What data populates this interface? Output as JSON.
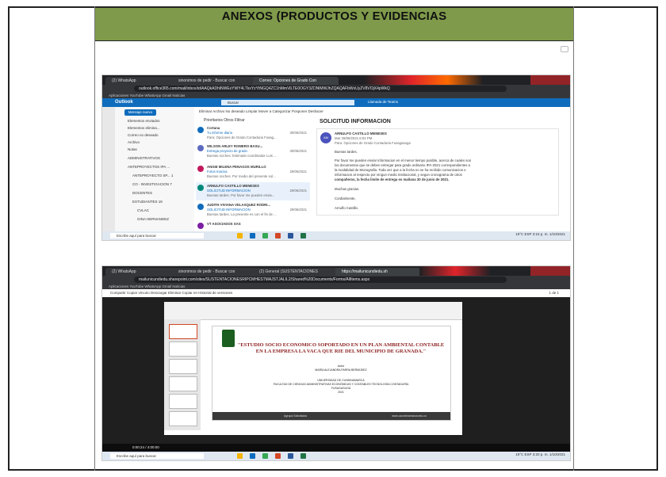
{
  "document": {
    "title": "ANEXOS (PRODUCTOS Y EVIDENCIAS"
  },
  "colors": {
    "header_bg": "#7f9a4a",
    "outlook_blue": "#0f6cbd",
    "taskbar": "#dfe7f1"
  },
  "outlook_screenshot": {
    "tabs": [
      "(2) WhatsApp",
      "sinonimos de pedir - Buscar con",
      "Correo: Opciones de Grado Con"
    ],
    "url": "outlook.office365.com/mail/inbox/id/AAQkADhlNWExYWY4LTkxYzYtNGQ4ZC1hMmVlLTE0OGY3ZDNlMWJhZQAQAFbWxUyZV8VOjX4pWkQ",
    "bookmarks": "Aplicaciones   YouTube   WhatsApp   Gmail   Noticias",
    "app_name": "Outlook",
    "search_placeholder": "Buscar",
    "header_text": "Llamada de Teams",
    "new_message": "Mensaje nuevo",
    "folders": [
      "Elementos enviados",
      "Elementos elimina...",
      "Correo no deseado",
      "Archivo",
      "Notas",
      "ADMINISTRATIVOS",
      "ANTEPROYECTOS IPA ...",
      "ANTEPROYECTO SP... 1",
      "CO - INVESTIGACION 7",
      "DOCENTES",
      "ESTUDIANTES 19",
      "CVLAC",
      "GINA HERNANDEZ"
    ],
    "toolbar": "Eliminar   Archivo   No deseado   Limpiar   Mover a   Categorizar   Posponer   Deshacer",
    "list_tabs": "Prioritarios   Otros          Filtrar",
    "messages": [
      {
        "from": "Cortana",
        "subject": "Tu informe diario",
        "preview": "Para: Opciones de Grado Contaduria Fusag...",
        "date": "30/06/2021"
      },
      {
        "from": "WILSON ARLEY ROMERO BASU...",
        "subject": "Entrega proyecto de grado",
        "preview": "Buenas noches. Estimado coordinador Luis ...",
        "date": "30/06/2021"
      },
      {
        "from": "ANGIE MILENA PENAGOS MURILLO",
        "subject": "Fotos Inaciva",
        "preview": "Buenas noches. Por medio del presente sol...",
        "date": "29/06/2021"
      },
      {
        "from": "ARNULFO CASTILLO MENESES",
        "subject": "SOLICITUD INFORMACION",
        "preview": "Buenas tardes. Por favor me pueden envia...",
        "date": "29/06/2021"
      },
      {
        "from": "JUDITH VIVIANA VELASQUEZ RODRI...",
        "subject": "SOLICITUD INFORMACION",
        "preview": "Buenas tardes. La presente es con el fin de ...",
        "date": "29/06/2021"
      },
      {
        "from": "VT ASOCIADOS SAS",
        "subject": "",
        "preview": "",
        "date": ""
      }
    ],
    "read_subject": "SOLICITUD INFORMACION",
    "read_avatar": "AM",
    "read_from": "ARNULFO CASTILLO MENESES",
    "read_date": "Mar 29/06/2021 6:04 PM",
    "read_to": "Para: Opciones de Grado Contaduria Fusagasuga",
    "read_greeting": "Buenas tardes.",
    "read_body_1": "Por favor me pueden enviar informacion en el menor tiempo posible, acerca de cuales son",
    "read_body_2": "los documentos que se deben entregar para grado ordinario IPA-2021 correspondientes a",
    "read_body_3": "la modalidad de Monografia. Toda vez que a la fecha no se ha recibido comunicacion e",
    "read_body_4": "informacion al respecto por ningun medio institucional, y segun cronograma de otros",
    "read_body_5": "compañeros, la fecha limite de entrega es mañana 30 de junio de 2021.",
    "read_thanks": "Muchas gracias.",
    "read_close": "Cordialmente,",
    "read_sign": "Arnulfo Castillo.",
    "taskbar_search": "Escribe aquí para buscar",
    "tray": "19°C   ESP   3:15 p. m.  1/10/2021"
  },
  "sharepoint_screenshot": {
    "tabs": [
      "(2) WhatsApp",
      "sinonimos de pedir - Buscar con",
      "(2) General (SUSTENTACIONES",
      "https://mailunicundiedu.sh"
    ],
    "url": "mailunicundiedu.sharepoint.com/sites/SUSTENTACIONESRIPCMHESTMAJSTJALIL2/Shared%20Documents/Forms/AllItems.aspx",
    "bookmarks": "Aplicaciones   YouTube   WhatsApp   Gmail   Noticias",
    "actions": "Compartir   Copiar vínculo   Descargar   Eliminar   Copiar en   Historial de versiones",
    "pager": "1 de 1",
    "slide_title": "\"ESTUDIO SOCIO ECONOMICO SOPORTADO EN UN PLAN AMBIENTAL CONTABLE EN LA EMPRESA LA VACA QUE RIE DEL MUNICIPIO DE GRANADA.\"",
    "slide_author_label": "Autor",
    "slide_author": "MARÍA ALEJANDRA PARRA BERMÚDEZ",
    "slide_institution": "UNIVERSIDAD DE CUNDINAMARCA",
    "slide_faculty": "FACULTAD DE CIENCIAS ADMINISTRATIVAS ECONÓMICAS Y CONTABLES TECNOLOGÍA CONTADURÍA",
    "slide_city": "FUSAGASUGÁ",
    "slide_year": "2021",
    "slide_footer_left": "Agrupa Solicitados",
    "slide_footer_right": "www.ucundinamarca.edu.co",
    "media_time": "0:00:24 / 4:00:00",
    "taskbar_search": "Escribe aquí para buscar",
    "tray": "19°C   ESP   3:20 p. m.  1/10/2021"
  }
}
